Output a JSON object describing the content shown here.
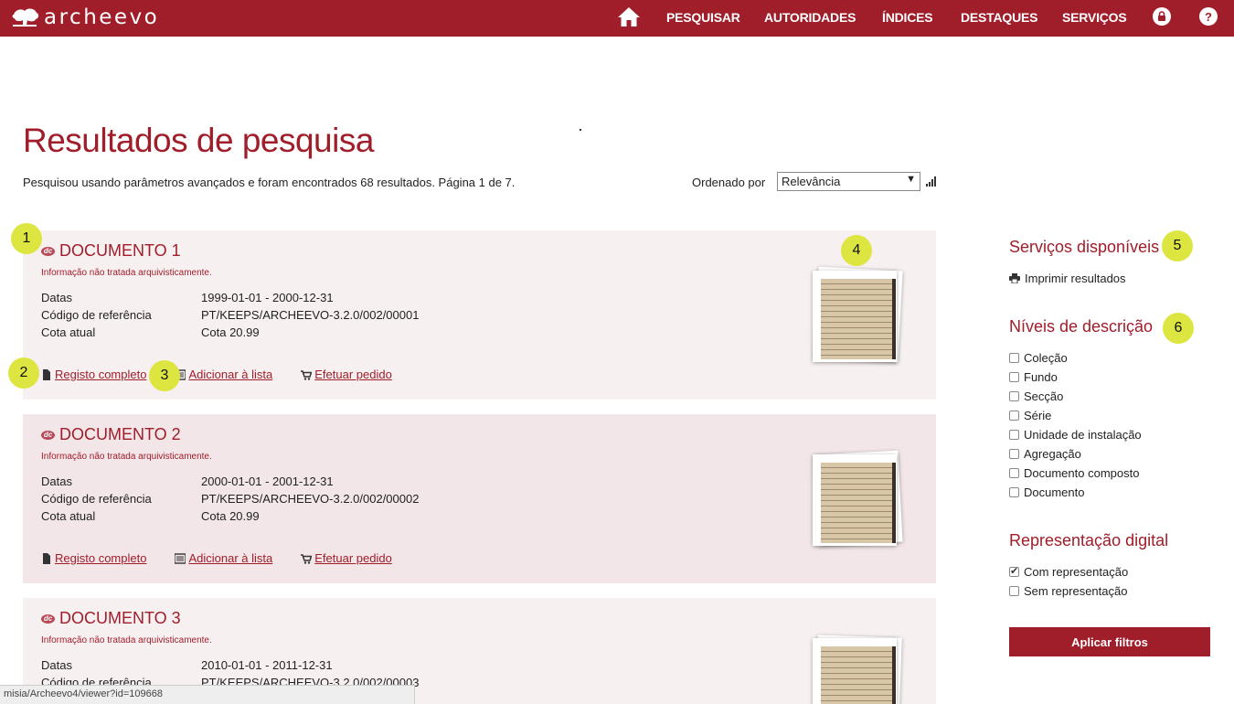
{
  "app": {
    "logo_text": "archeevo"
  },
  "nav": {
    "items": [
      "PESQUISAR",
      "AUTORIDADES",
      "ÍNDICES",
      "DESTAQUES",
      "SERVIÇOS"
    ],
    "help_label": "?",
    "icons": [
      "home-icon",
      "lock-icon",
      "help-icon"
    ]
  },
  "header": {
    "title": "Resultados de pesquisa",
    "summary": "Pesquisou usando parâmetros avançados e foram encontrados 68 resultados. Página 1 de 7.",
    "sort_label": "Ordenado por",
    "sort_value": "Relevância"
  },
  "results": [
    {
      "badge": "dc",
      "title": "DOCUMENTO 1",
      "note": "Informação não tratada arquivisticamente.",
      "fields": [
        {
          "label": "Datas",
          "value": "1999-01-01 - 2000-12-31"
        },
        {
          "label": "Código de referência",
          "value": "PT/KEEPS/ARCHEEVO-3.2.0/002/00001"
        },
        {
          "label": "Cota atual",
          "value": "Cota 20.99"
        }
      ],
      "actions": [
        "Registo completo",
        "Adicionar à lista",
        "Efetuar pedido"
      ]
    },
    {
      "badge": "dc",
      "title": "DOCUMENTO 2",
      "note": "Informação não tratada arquivisticamente.",
      "fields": [
        {
          "label": "Datas",
          "value": "2000-01-01 - 2001-12-31"
        },
        {
          "label": "Código de referência",
          "value": "PT/KEEPS/ARCHEEVO-3.2.0/002/00002"
        },
        {
          "label": "Cota atual",
          "value": "Cota 20.99"
        }
      ],
      "actions": [
        "Registo completo",
        "Adicionar à lista",
        "Efetuar pedido"
      ]
    },
    {
      "badge": "dc",
      "title": "DOCUMENTO 3",
      "note": "Informação não tratada arquivisticamente.",
      "fields": [
        {
          "label": "Datas",
          "value": "2010-01-01 - 2011-12-31"
        },
        {
          "label": "Código de referência",
          "value": "PT/KEEPS/ARCHEEVO-3.2.0/002/00003"
        }
      ]
    }
  ],
  "markers": [
    "1",
    "2",
    "3",
    "4",
    "5",
    "6"
  ],
  "sidebar": {
    "services_heading": "Serviços disponíveis",
    "print_label": "Imprimir resultados",
    "levels_heading": "Níveis de descrição",
    "levels": [
      {
        "label": "Coleção",
        "checked": false
      },
      {
        "label": "Fundo",
        "checked": false
      },
      {
        "label": "Secção",
        "checked": false
      },
      {
        "label": "Série",
        "checked": false
      },
      {
        "label": "Unidade de instalação",
        "checked": false
      },
      {
        "label": "Agregação",
        "checked": false
      },
      {
        "label": "Documento composto",
        "checked": false
      },
      {
        "label": "Documento",
        "checked": false
      }
    ],
    "digital_heading": "Representação digital",
    "digital": [
      {
        "label": "Com representação",
        "checked": true
      },
      {
        "label": "Sem representação",
        "checked": false
      }
    ],
    "apply_label": "Aplicar filtros"
  },
  "status": {
    "url": "misia/Archeevo4/viewer?id=109668"
  },
  "colors": {
    "brand": "#a01d2a",
    "card_bg": "#f7f0f1",
    "card_bg_alt": "#f2e6e8",
    "marker": "#dde640"
  }
}
